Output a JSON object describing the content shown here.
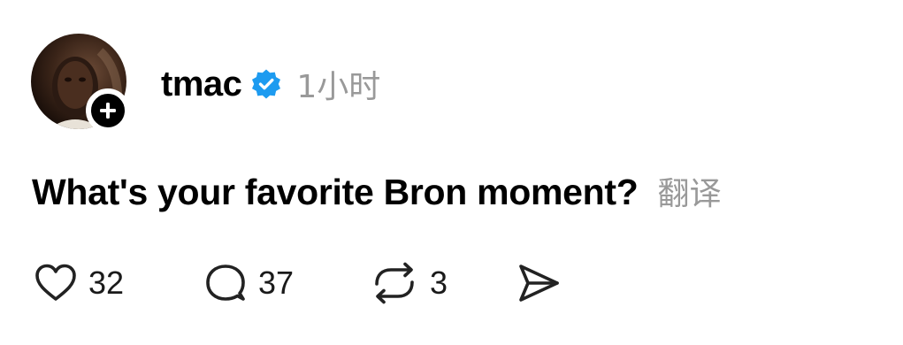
{
  "post": {
    "username": "tmac",
    "time": "1小时",
    "text": "What's your favorite Bron moment?",
    "translate_label": "翻译",
    "verified": true,
    "stats": {
      "likes": "32",
      "replies": "37",
      "reposts": "3"
    }
  },
  "icons": {
    "like": "heart-icon",
    "reply": "speech-bubble-icon",
    "repost": "repost-icon",
    "share": "send-icon",
    "verified": "verified-badge-icon",
    "follow": "plus-icon"
  },
  "colors": {
    "verified_blue": "#1d9bf0",
    "muted_text": "#999999",
    "primary_text": "#000000"
  }
}
